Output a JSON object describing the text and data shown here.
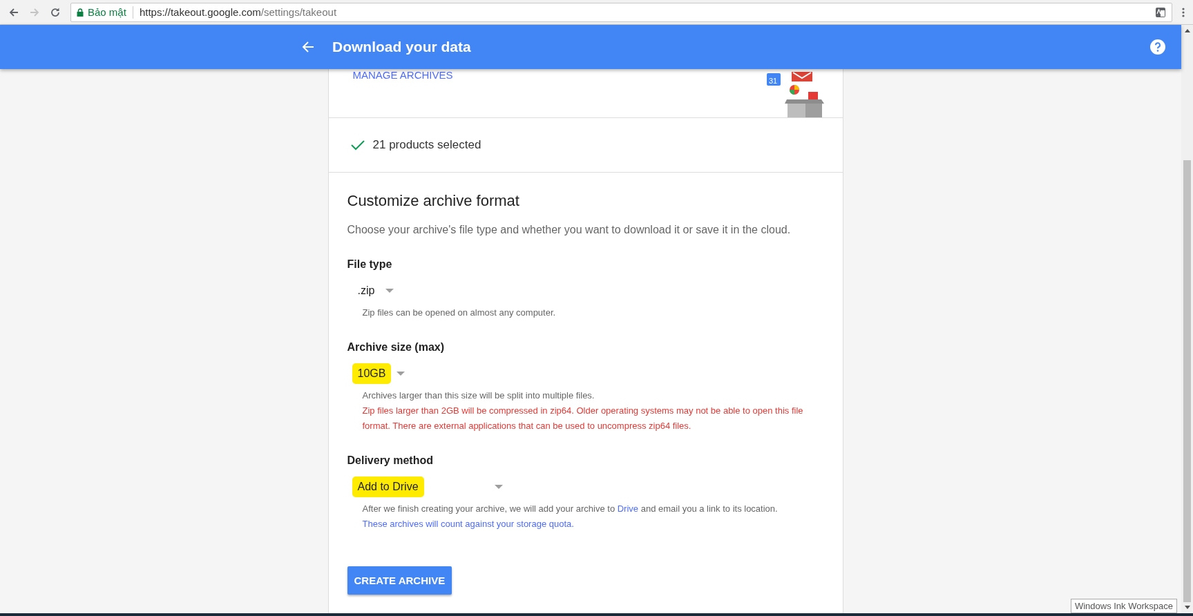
{
  "browser": {
    "back_enabled": true,
    "forward_enabled": false,
    "security_label": "Bảo mật",
    "url_host": "https://takeout.google.com",
    "url_path": "/settings/takeout"
  },
  "header": {
    "title": "Download your data"
  },
  "manage_link": "MANAGE ARCHIVES",
  "calendar_day": "31",
  "selection": {
    "text": "21 products selected"
  },
  "section": {
    "title": "Customize archive format",
    "description": "Choose your archive's file type and whether you want to download it or save it in the cloud."
  },
  "fields": [
    {
      "label": "File type",
      "value": ".zip",
      "highlighted": false,
      "wide": false,
      "hints": [
        {
          "kind": "note",
          "text": "Zip files can be opened on almost any computer."
        }
      ]
    },
    {
      "label": "Archive size (max)",
      "value": "10GB",
      "highlighted": true,
      "wide": false,
      "hints": [
        {
          "kind": "note",
          "text": "Archives larger than this size will be split into multiple files."
        },
        {
          "kind": "warning",
          "text": "Zip files larger than 2GB will be compressed in zip64. Older operating systems may not be able to open this file format. There are external applications that can be used to uncompress zip64 files."
        }
      ]
    },
    {
      "label": "Delivery method",
      "value": "Add to Drive",
      "highlighted": true,
      "wide": true,
      "hints": [
        {
          "kind": "rich",
          "segments": [
            {
              "kind": "text",
              "text": "After we finish creating your archive, we will add your archive to "
            },
            {
              "kind": "link",
              "text": "Drive"
            },
            {
              "kind": "text",
              "text": " and email you a link to its location. "
            },
            {
              "kind": "link",
              "text": "These archives will count against your storage quota."
            }
          ]
        }
      ]
    }
  ],
  "create_button": "CREATE ARCHIVE",
  "tooltip": "Windows Ink Workspace"
}
